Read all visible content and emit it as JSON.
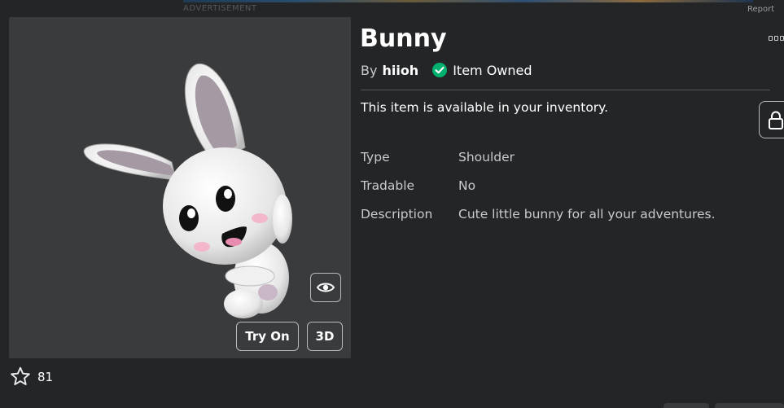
{
  "ad": {
    "label": "ADVERTISEMENT",
    "report": "Report"
  },
  "item": {
    "name": "Bunny",
    "by_label": "By",
    "creator": "hiioh",
    "owned_label": "Item Owned",
    "availability": "This item is available in your inventory.",
    "details": [
      {
        "label": "Type",
        "value": "Shoulder"
      },
      {
        "label": "Tradable",
        "value": "No"
      },
      {
        "label": "Description",
        "value": "Cute little bunny for all your adventures."
      }
    ]
  },
  "preview": {
    "try_on_label": "Try On",
    "view_3d_label": "3D",
    "favorites_count": "81"
  },
  "icons": {
    "owned": "check-circle-icon",
    "eye": "eye-icon",
    "favorite": "star-outline-icon",
    "more": "more-options-icon",
    "lock": "lock-icon"
  },
  "colors": {
    "background": "#232527",
    "panel": "#393b3d",
    "owned_check": "#00b06f",
    "text_secondary": "#c9cbcd"
  }
}
